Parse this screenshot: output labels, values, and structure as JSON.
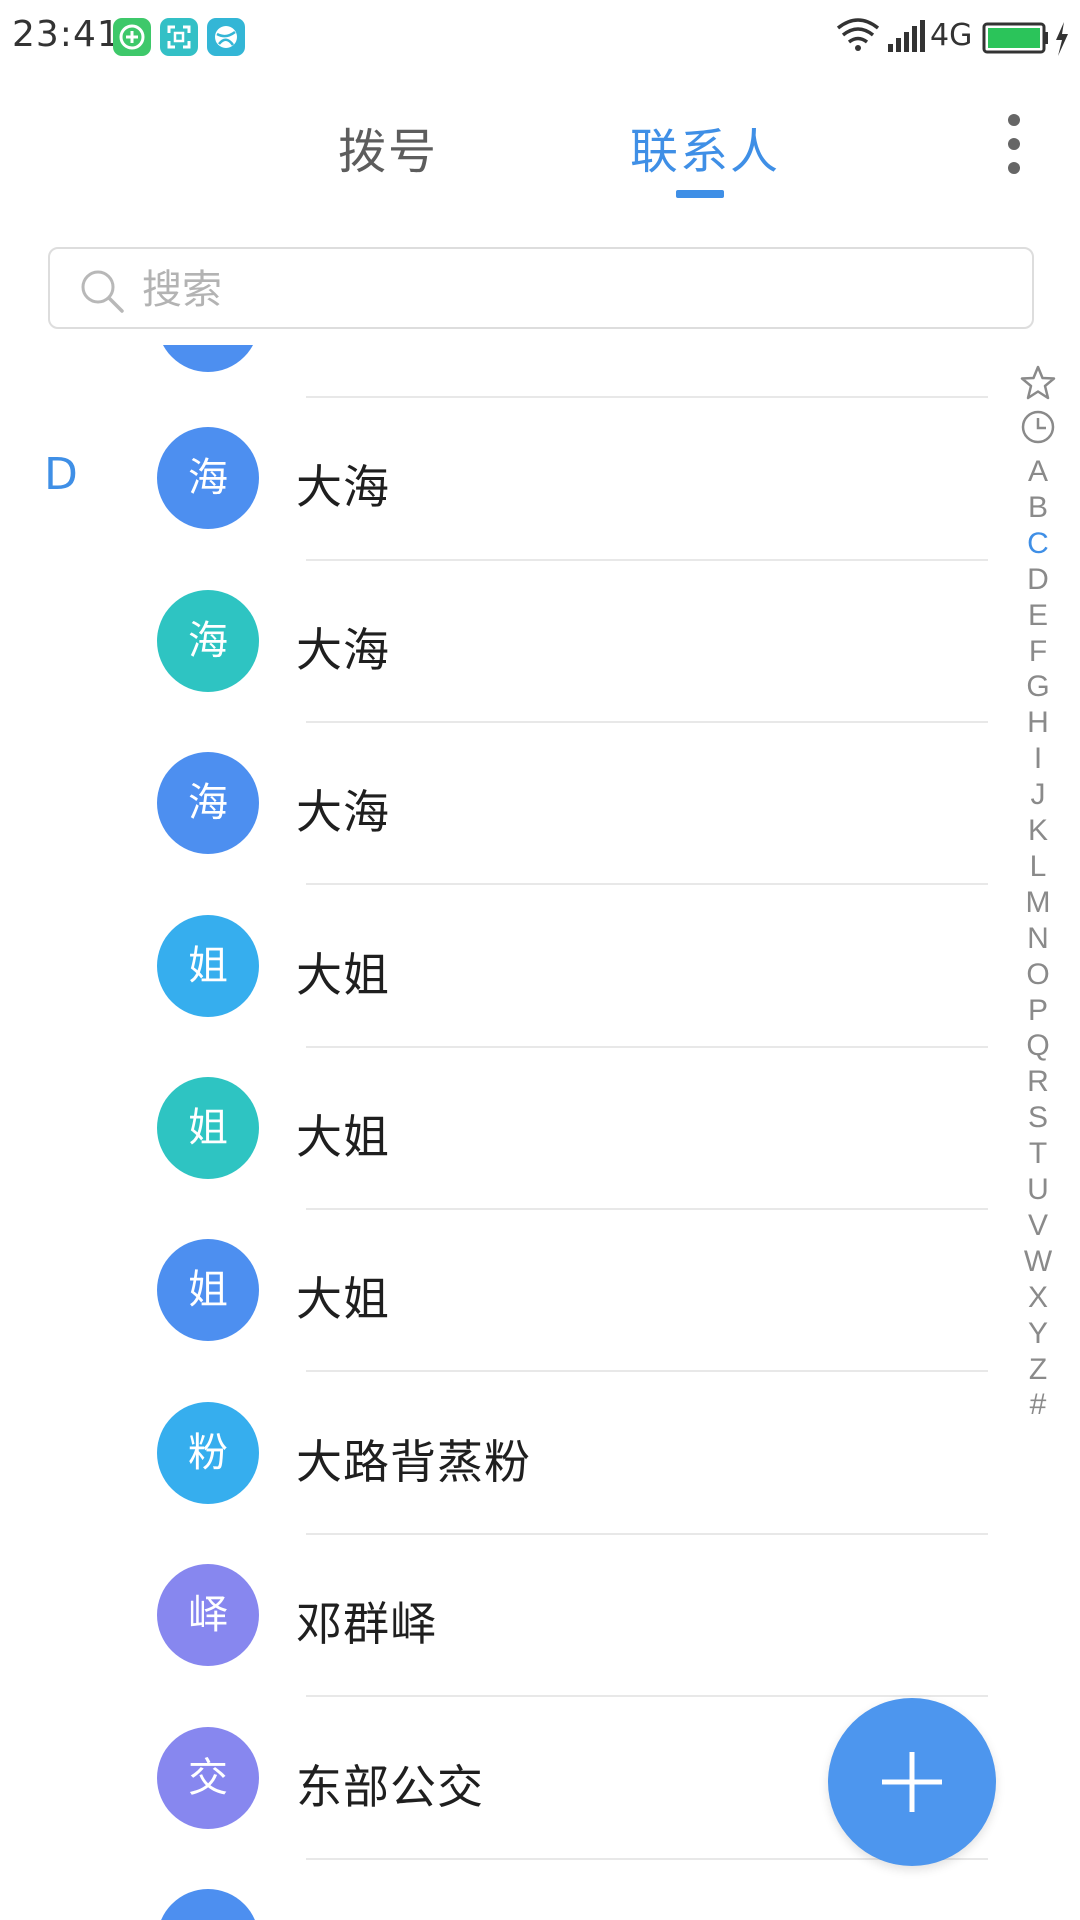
{
  "status_bar": {
    "time": "23:41",
    "network": "4G",
    "icons": [
      "plus-circle-app-icon",
      "scan-app-icon",
      "ball-app-icon",
      "wifi-icon",
      "signal-icon",
      "battery-charging-icon"
    ],
    "app_icon_colors": [
      "#3ec86a",
      "#33c0c6",
      "#33b6d6"
    ]
  },
  "tabs": [
    {
      "label": "拨号",
      "active": false
    },
    {
      "label": "联系人",
      "active": true
    }
  ],
  "accent_color": "#3f8fe6",
  "search": {
    "placeholder": "搜索",
    "value": ""
  },
  "contacts": [
    {
      "section": "D",
      "avatar_char": "海",
      "avatar_color": "#4d8ff0",
      "name": "大海"
    },
    {
      "section": "",
      "avatar_char": "海",
      "avatar_color": "#2ec4c2",
      "name": "大海"
    },
    {
      "section": "",
      "avatar_char": "海",
      "avatar_color": "#4d8ff0",
      "name": "大海"
    },
    {
      "section": "",
      "avatar_char": "姐",
      "avatar_color": "#36aeee",
      "name": "大姐"
    },
    {
      "section": "",
      "avatar_char": "姐",
      "avatar_color": "#2ec4c2",
      "name": "大姐"
    },
    {
      "section": "",
      "avatar_char": "姐",
      "avatar_color": "#4d8ff0",
      "name": "大姐"
    },
    {
      "section": "",
      "avatar_char": "粉",
      "avatar_color": "#36aeee",
      "name": "大路背蒸粉"
    },
    {
      "section": "",
      "avatar_char": "峄",
      "avatar_color": "#8787ef",
      "name": "邓群峄"
    },
    {
      "section": "",
      "avatar_char": "交",
      "avatar_color": "#8787ef",
      "name": "东部公交"
    }
  ],
  "alphabet_index": {
    "icons": [
      "star-icon",
      "clock-icon"
    ],
    "letters": [
      "A",
      "B",
      "C",
      "D",
      "E",
      "F",
      "G",
      "H",
      "I",
      "J",
      "K",
      "L",
      "M",
      "N",
      "O",
      "P",
      "Q",
      "R",
      "S",
      "T",
      "U",
      "V",
      "W",
      "X",
      "Y",
      "Z",
      "#"
    ],
    "active_letter": "C"
  },
  "fab": {
    "icon": "plus-icon",
    "color": "#4d96ee"
  }
}
